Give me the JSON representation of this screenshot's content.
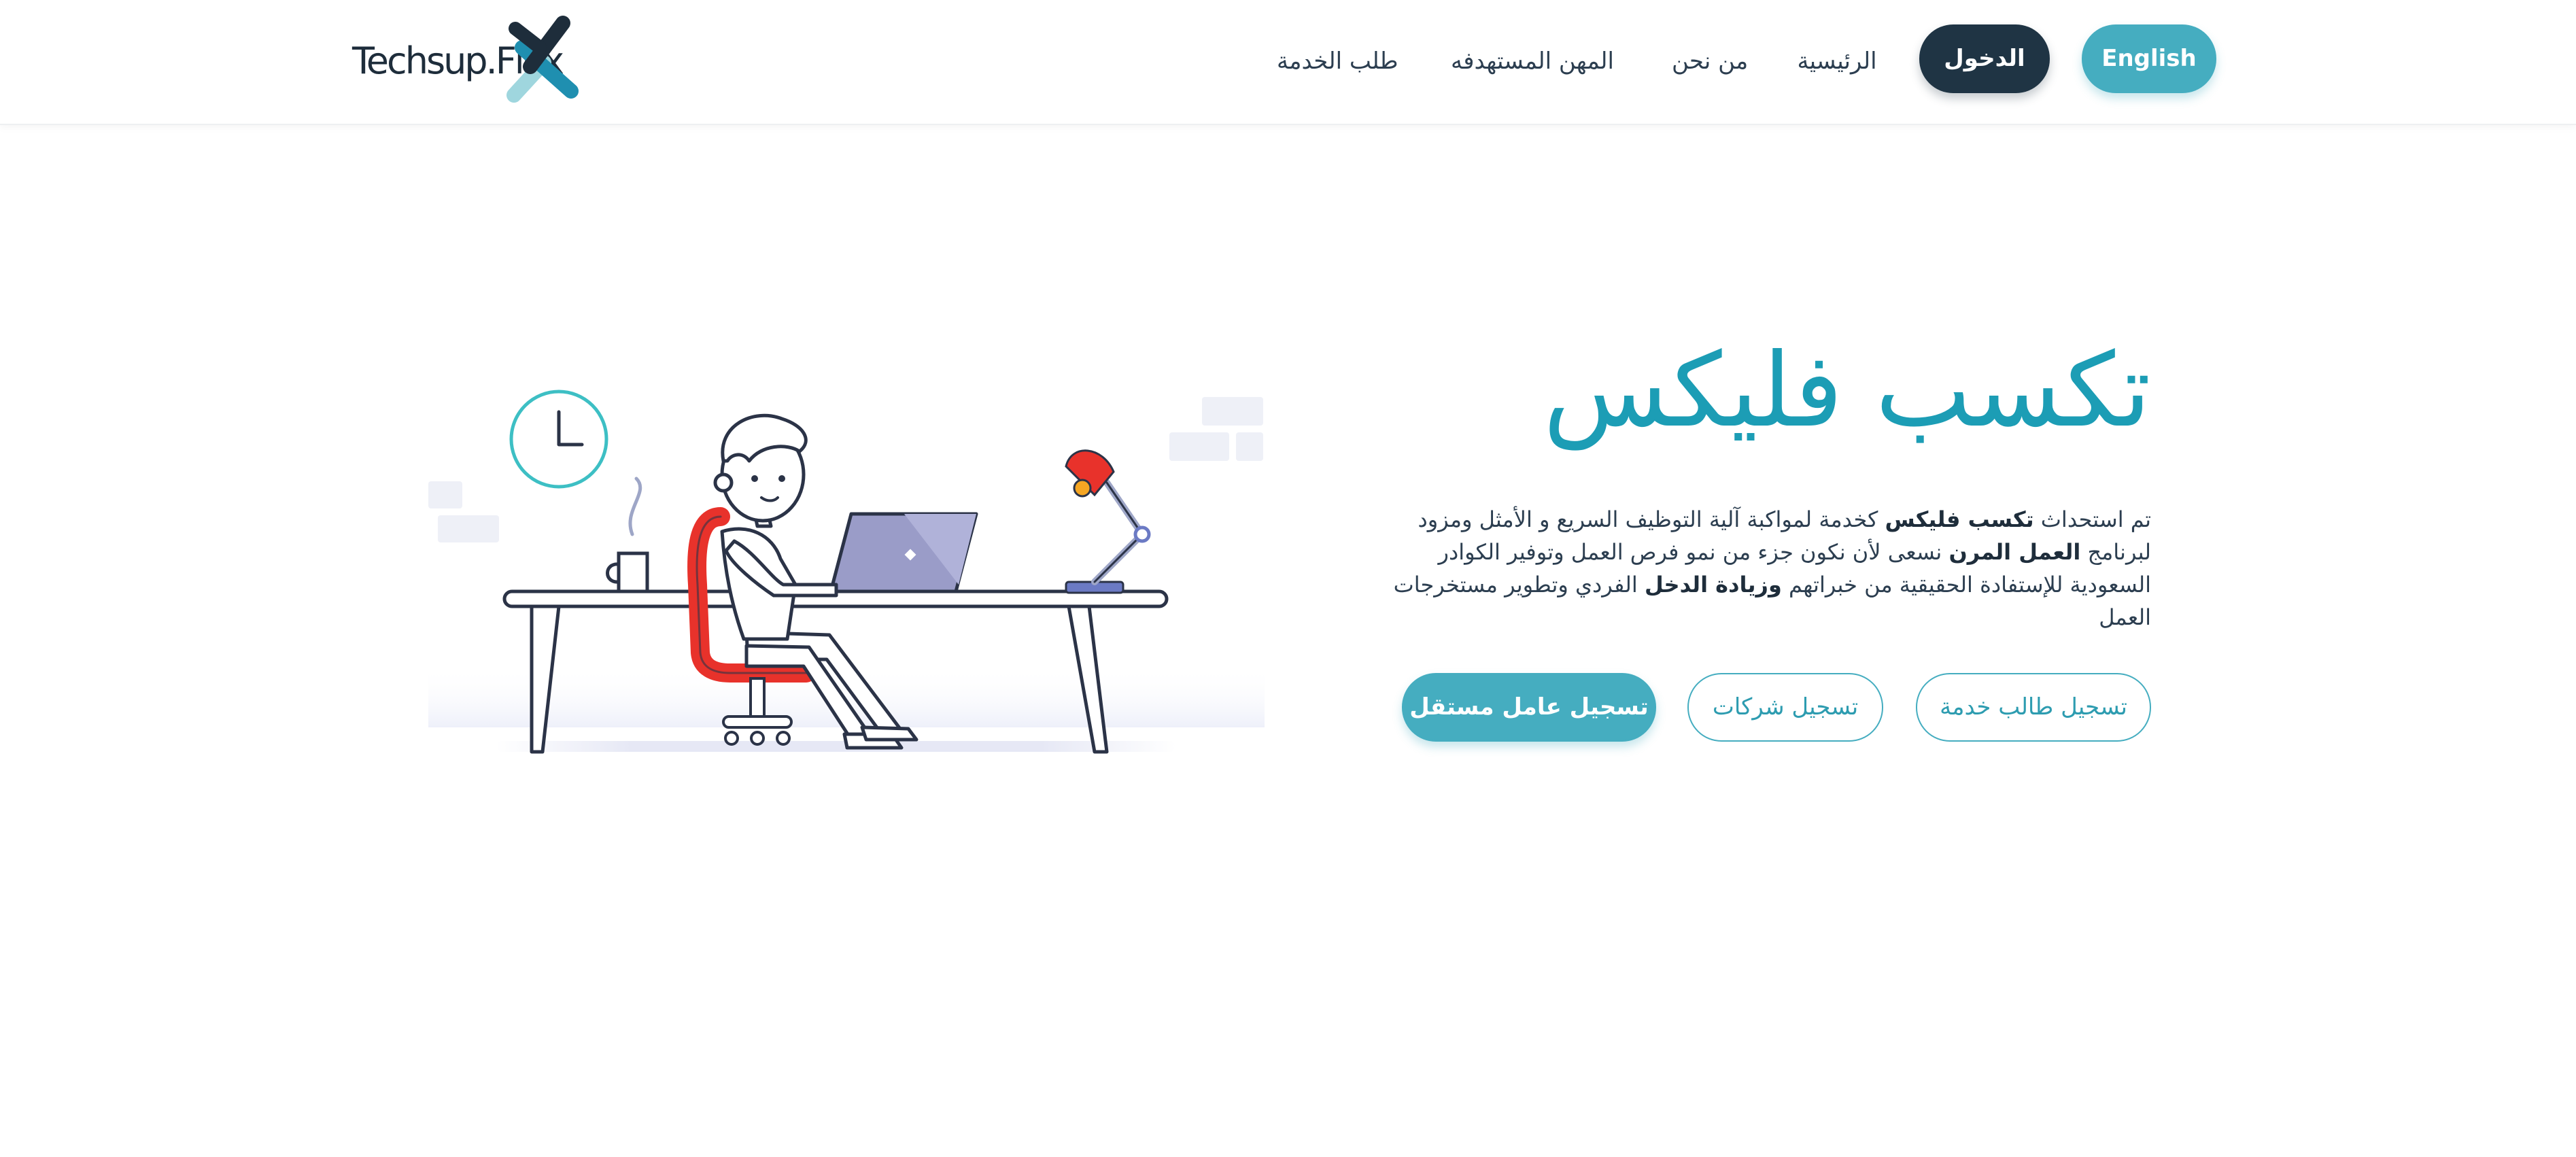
{
  "header": {
    "logo_text": "Techsup.Flex",
    "nav": {
      "home": "الرئيسية",
      "about": "من نحن",
      "professions": "المهن المستهدفه",
      "service_request": "طلب الخدمة"
    },
    "login_label": "الدخول",
    "language_label": "English"
  },
  "hero": {
    "title": "تكسب فليكس",
    "description": {
      "p1_before": "تم استحداث ",
      "p1_bold": "تكسب فليكس",
      "p1_after": " كخدمة لمواكبة آلية التوظيف السريع و الأمثل ومزود لبرنامج ",
      "p2_bold": "العمل المرن",
      "p2_after": " نسعى لأن نكون جزء من نمو فرص العمل وتوفير الكوادر السعودية للإستفادة الحقيقية من خبراتهم ",
      "p3_bold": "وزيادة الدخل",
      "p3_after": " الفردي وتطوير مستخرجات العمل"
    },
    "buttons": {
      "register_service_seeker": "تسجيل طالب خدمة",
      "register_companies": "تسجيل شركات",
      "register_freelancer": "تسجيل عامل مستقل"
    }
  },
  "colors": {
    "accent": "#45adc0",
    "title": "#1c9db5",
    "dark": "#1f3444",
    "chair": "#e8322b"
  },
  "icons": {
    "logo": "x-cross-logo-icon",
    "illustration": "person-at-desk-illustration"
  }
}
